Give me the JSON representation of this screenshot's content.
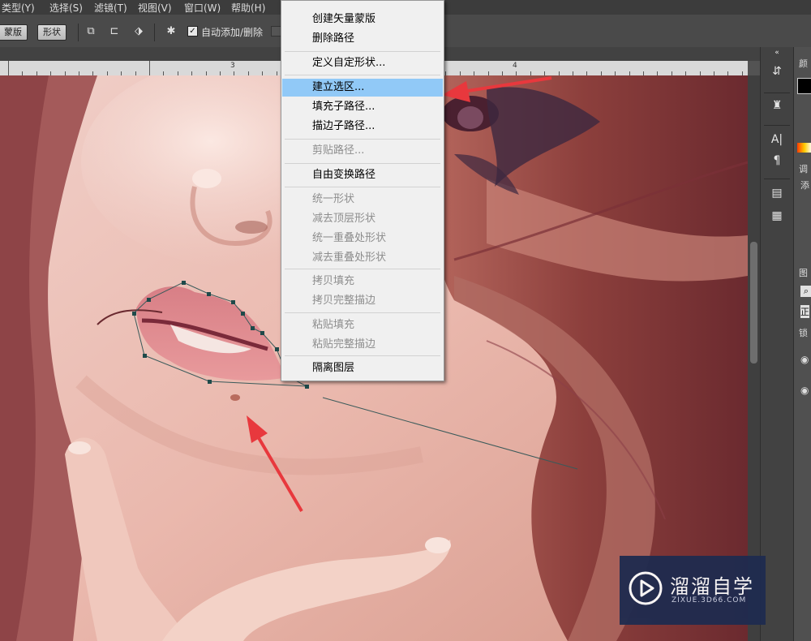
{
  "menubar": {
    "items": [
      "类型(Y)",
      "选择(S)",
      "滤镜(T)",
      "视图(V)",
      "窗口(W)",
      "帮助(H)"
    ]
  },
  "options": {
    "mask_button": "蒙版",
    "shape_button": "形状",
    "auto_add_delete_label": "自动添加/删除",
    "auto_add_delete_checked": true
  },
  "ruler": {
    "labels": [
      "3",
      "4"
    ]
  },
  "context_menu": {
    "items": [
      {
        "label": "创建矢量蒙版",
        "enabled": true
      },
      {
        "label": "删除路径",
        "enabled": true
      },
      {
        "label": "定义自定形状...",
        "enabled": true
      },
      {
        "label": "建立选区...",
        "enabled": true,
        "highlighted": true
      },
      {
        "label": "填充子路径...",
        "enabled": true
      },
      {
        "label": "描边子路径...",
        "enabled": true
      },
      {
        "label": "剪贴路径...",
        "enabled": false
      },
      {
        "label": "自由变换路径",
        "enabled": true
      },
      {
        "label": "统一形状",
        "enabled": false
      },
      {
        "label": "减去顶层形状",
        "enabled": false
      },
      {
        "label": "统一重叠处形状",
        "enabled": false
      },
      {
        "label": "减去重叠处形状",
        "enabled": false
      },
      {
        "label": "拷贝填充",
        "enabled": false
      },
      {
        "label": "拷贝完整描边",
        "enabled": false
      },
      {
        "label": "粘贴填充",
        "enabled": false
      },
      {
        "label": "粘贴完整描边",
        "enabled": false
      },
      {
        "label": "隔离图层",
        "enabled": true
      }
    ]
  },
  "right_panel": {
    "labels": [
      "颜",
      "调",
      "添",
      "图",
      "正",
      "锁"
    ]
  },
  "watermark": {
    "title": "溜溜自学",
    "subtitle": "ZIXUE.3D66.COM"
  },
  "colors": {
    "highlight": "#91c9f7",
    "arrow": "#e8383d",
    "path": "#3a5a5a"
  }
}
